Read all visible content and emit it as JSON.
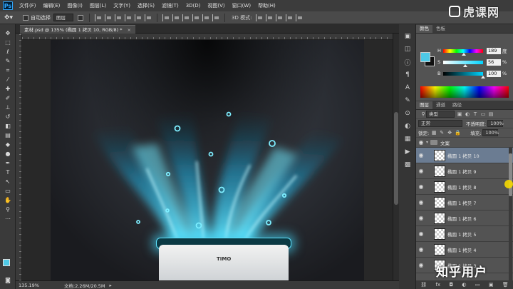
{
  "menu": {
    "logo": "Ps",
    "items": [
      "文件(F)",
      "编辑(E)",
      "图像(I)",
      "图层(L)",
      "文字(Y)",
      "选择(S)",
      "滤镜(T)",
      "3D(D)",
      "视图(V)",
      "窗口(W)",
      "帮助(H)"
    ]
  },
  "options": {
    "tool_icon": "move-tool",
    "auto_select_label": "自动选择",
    "auto_select_value": "图层",
    "mode_3d": "3D 模式:"
  },
  "document": {
    "tab_title": "素材.psd @ 135% (椭圆 1 拷贝 10, RGB/8) *",
    "close_glyph": "×",
    "logo_text": "TIMO"
  },
  "status": {
    "zoom": "135.19%",
    "doc_size": "文档:2.26M/20.5M"
  },
  "color_panel": {
    "tabs": [
      "颜色",
      "色板"
    ],
    "active_tab": 0,
    "foreground": "#4ec9e6",
    "background": "#111111",
    "sliders": [
      {
        "label": "H",
        "value": "189",
        "unit": "度",
        "knob": 0.52
      },
      {
        "label": "S",
        "value": "56",
        "unit": "%",
        "knob": 0.56
      },
      {
        "label": "B",
        "value": "100",
        "unit": "%",
        "knob": 1.0
      }
    ]
  },
  "layers_panel": {
    "tabs": [
      "图层",
      "通道",
      "路径"
    ],
    "active_tab": 0,
    "filter_kind": "类型",
    "blend_mode": "正常",
    "opacity_label": "不透明度:",
    "opacity_value": "100%",
    "lock_label": "锁定:",
    "fill_label": "填充:",
    "fill_value": "100%",
    "group_name": "文案",
    "layers": [
      {
        "name": "椭圆 1 拷贝 10",
        "selected": true
      },
      {
        "name": "椭圆 1 拷贝 9",
        "selected": false
      },
      {
        "name": "椭圆 1 拷贝 8",
        "selected": false
      },
      {
        "name": "椭圆 1 拷贝 7",
        "selected": false
      },
      {
        "name": "椭圆 1 拷贝 6",
        "selected": false
      },
      {
        "name": "椭圆 1 拷贝 5",
        "selected": false
      },
      {
        "name": "椭圆 1 拷贝 4",
        "selected": false
      },
      {
        "name": "椭圆 1 拷贝 3",
        "selected": false
      }
    ],
    "footer_icons": [
      "link-icon",
      "fx-icon",
      "mask-icon",
      "adjustment-icon",
      "folder-icon",
      "new-layer-icon",
      "trash-icon"
    ]
  },
  "watermarks": {
    "top": "虎课网",
    "bottom": "知乎用户"
  },
  "colors": {
    "glow": "#46d8ff",
    "selected_layer": "#6b7c92"
  }
}
